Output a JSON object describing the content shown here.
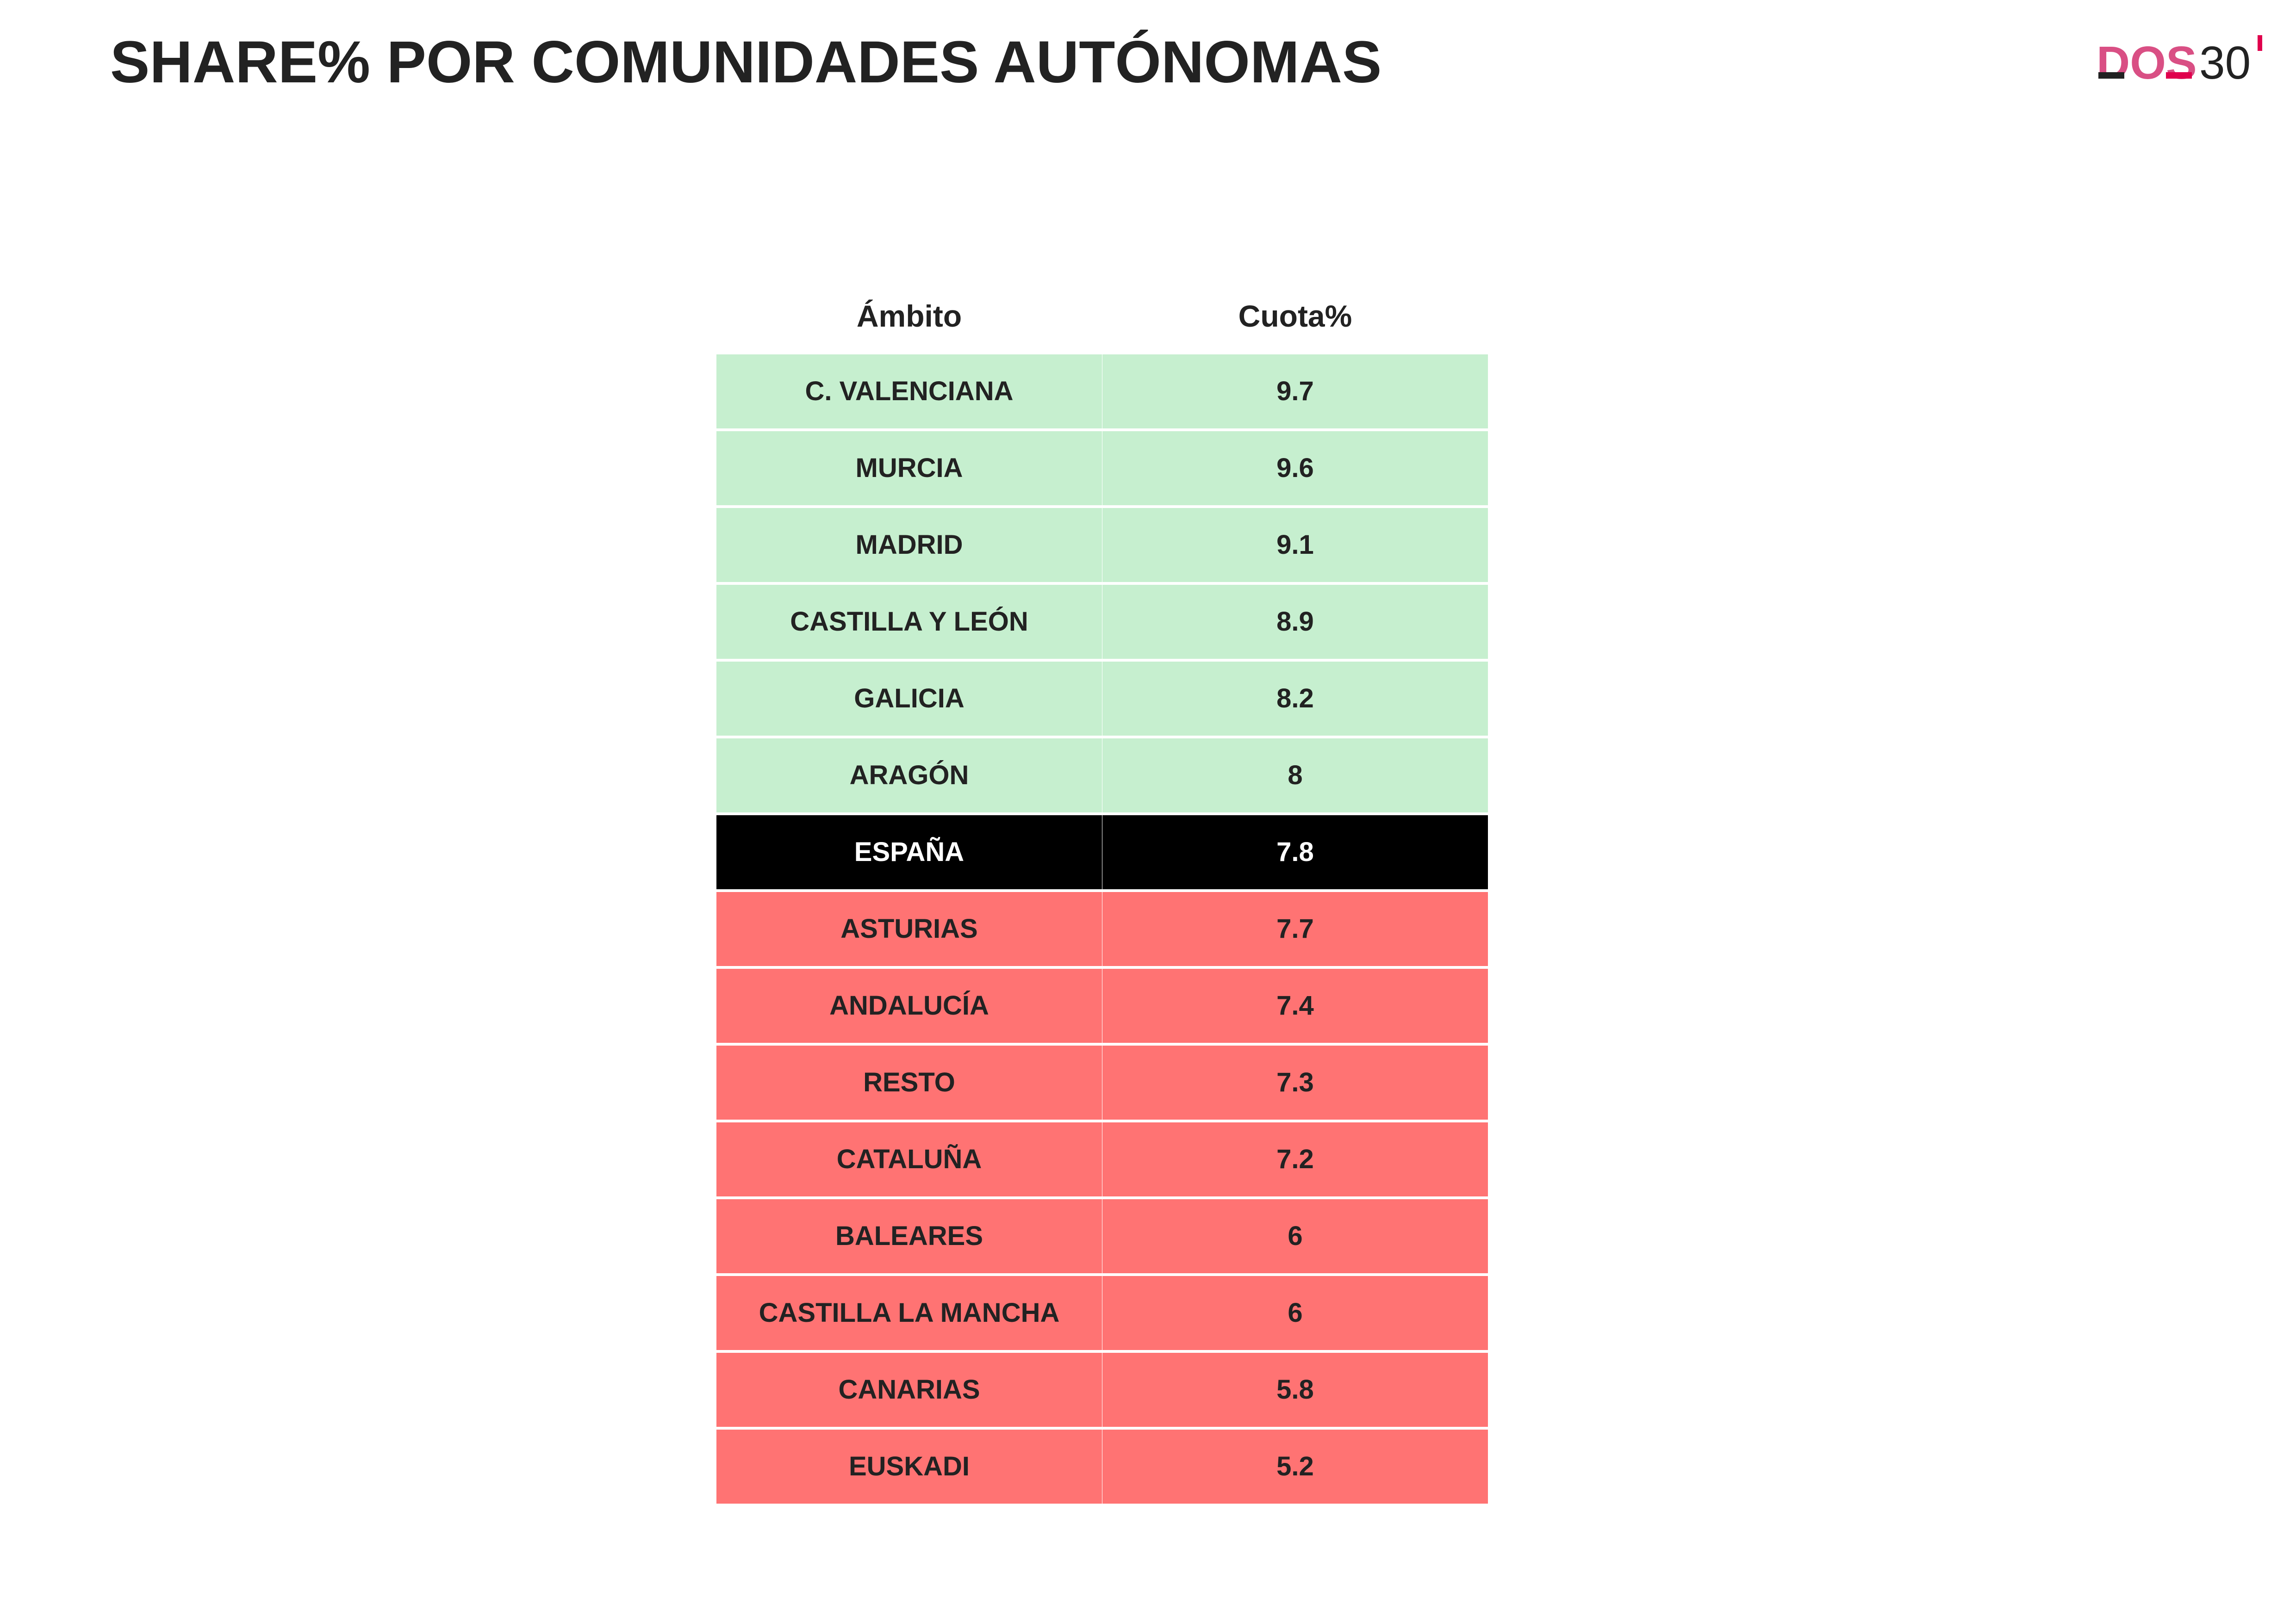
{
  "page": {
    "title": "SHARE% POR COMUNIDADES AUTÓNOMAS"
  },
  "logo": {
    "text_dos": "DOS",
    "text_num": "30",
    "colors": {
      "dos": "#d94f84",
      "num": "#222222",
      "accent": "#e0004d"
    }
  },
  "colors": {
    "above": "#c6efcf",
    "reference": "#000000",
    "below": "#ff7373",
    "text_dark": "#222222",
    "text_light": "#ffffff",
    "divider": "#ffffff"
  },
  "chart_data": {
    "type": "table",
    "columns": [
      "Ámbito",
      "Cuota%"
    ],
    "rows": [
      {
        "ambito": "C. VALENCIANA",
        "cuota": "9.7",
        "group": "above"
      },
      {
        "ambito": "MURCIA",
        "cuota": "9.6",
        "group": "above"
      },
      {
        "ambito": "MADRID",
        "cuota": "9.1",
        "group": "above"
      },
      {
        "ambito": "CASTILLA Y LEÓN",
        "cuota": "8.9",
        "group": "above"
      },
      {
        "ambito": "GALICIA",
        "cuota": "8.2",
        "group": "above"
      },
      {
        "ambito": "ARAGÓN",
        "cuota": "8",
        "group": "above"
      },
      {
        "ambito": "ESPAÑA",
        "cuota": "7.8",
        "group": "reference"
      },
      {
        "ambito": "ASTURIAS",
        "cuota": "7.7",
        "group": "below"
      },
      {
        "ambito": "ANDALUCÍA",
        "cuota": "7.4",
        "group": "below"
      },
      {
        "ambito": "RESTO",
        "cuota": "7.3",
        "group": "below"
      },
      {
        "ambito": "CATALUÑA",
        "cuota": "7.2",
        "group": "below"
      },
      {
        "ambito": "BALEARES",
        "cuota": "6",
        "group": "below"
      },
      {
        "ambito": "CASTILLA LA MANCHA",
        "cuota": "6",
        "group": "below"
      },
      {
        "ambito": "CANARIAS",
        "cuota": "5.8",
        "group": "below"
      },
      {
        "ambito": "EUSKADI",
        "cuota": "5.2",
        "group": "below"
      }
    ]
  }
}
